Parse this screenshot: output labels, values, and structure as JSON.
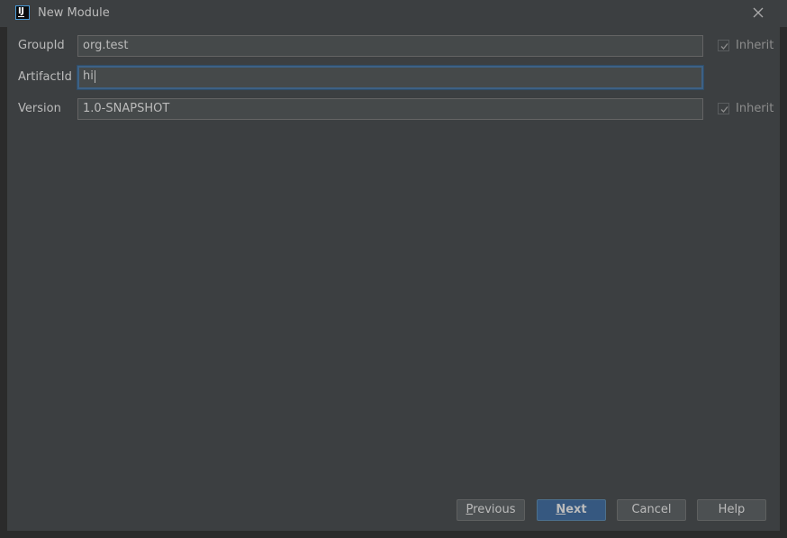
{
  "window": {
    "title": "New Module"
  },
  "form": {
    "rows": [
      {
        "label": "GroupId",
        "value": "org.test",
        "inherit_label": "Inherit",
        "inherit_checked": true
      },
      {
        "label": "ArtifactId",
        "value": "hi",
        "focused": true
      },
      {
        "label": "Version",
        "value": "1.0-SNAPSHOT",
        "inherit_label": "Inherit",
        "inherit_checked": true
      }
    ]
  },
  "buttons": {
    "previous": {
      "mnemonic": "P",
      "rest": "revious"
    },
    "next": {
      "mnemonic": "N",
      "rest": "ext"
    },
    "cancel": "Cancel",
    "help": "Help"
  },
  "colors": {
    "background": "#3c3f41",
    "field": "#45494a",
    "focus_border": "#3d6185",
    "primary_button": "#365880"
  },
  "icons": {
    "app": "intellij-icon",
    "close": "close-icon",
    "check": "checkmark-icon"
  }
}
